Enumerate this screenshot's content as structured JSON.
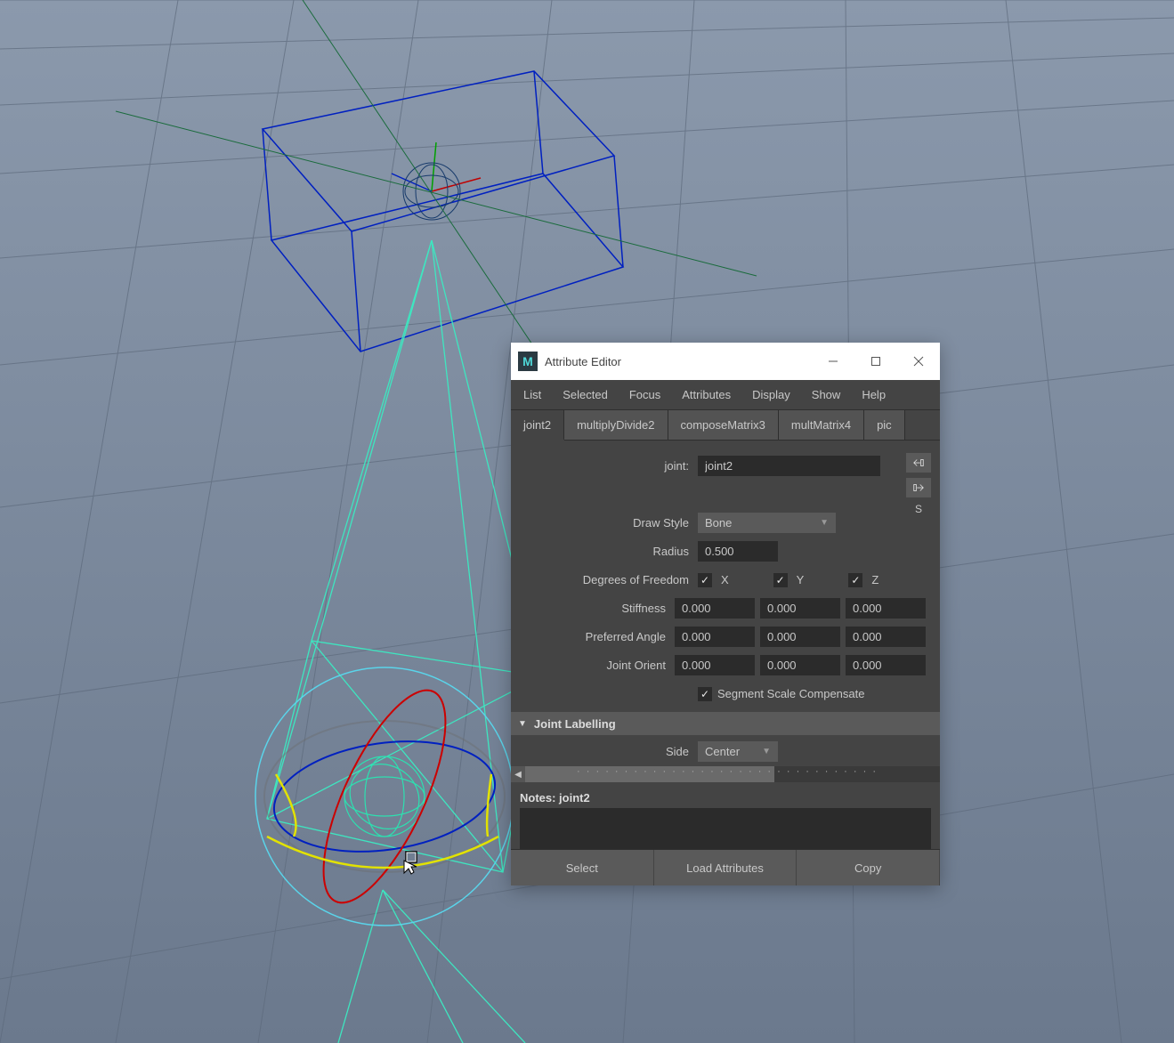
{
  "window": {
    "title": "Attribute Editor",
    "app_letter": "M"
  },
  "menu": {
    "list": "List",
    "selected": "Selected",
    "focus": "Focus",
    "attributes": "Attributes",
    "display": "Display",
    "show": "Show",
    "help": "Help"
  },
  "tabs": {
    "t0": "joint2",
    "t1": "multiplyDivide2",
    "t2": "composeMatrix3",
    "t3": "multMatrix4",
    "t4": "pic"
  },
  "side": {
    "s_label": "S"
  },
  "form": {
    "joint_label": "joint:",
    "joint_value": "joint2",
    "draw_style_label": "Draw Style",
    "draw_style_value": "Bone",
    "radius_label": "Radius",
    "radius_value": "0.500",
    "dof_label": "Degrees of Freedom",
    "dof_x": "X",
    "dof_y": "Y",
    "dof_z": "Z",
    "stiffness_label": "Stiffness",
    "stiffness": {
      "x": "0.000",
      "y": "0.000",
      "z": "0.000"
    },
    "pref_angle_label": "Preferred Angle",
    "pref_angle": {
      "x": "0.000",
      "y": "0.000",
      "z": "0.000"
    },
    "orient_label": "Joint Orient",
    "orient": {
      "x": "0.000",
      "y": "0.000",
      "z": "0.000"
    },
    "seg_scale_label": "Segment Scale Compensate",
    "section_labelling": "Joint Labelling",
    "side_label": "Side",
    "side_value": "Center"
  },
  "notes": {
    "label": "Notes:  joint2"
  },
  "footer": {
    "select": "Select",
    "load": "Load Attributes",
    "copy": "Copy "
  }
}
